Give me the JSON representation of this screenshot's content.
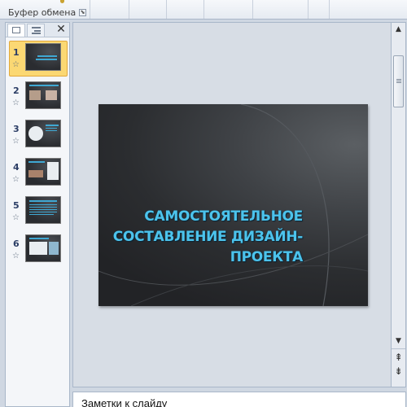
{
  "ribbon": {
    "group_label": "Буфер обмена",
    "launcher_glyph": "⬊"
  },
  "thumbnail_pane": {
    "close_glyph": "✕",
    "slides": [
      {
        "number": "1",
        "selected": true
      },
      {
        "number": "2",
        "selected": false
      },
      {
        "number": "3",
        "selected": false
      },
      {
        "number": "4",
        "selected": false
      },
      {
        "number": "5",
        "selected": false
      },
      {
        "number": "6",
        "selected": false
      }
    ],
    "star_glyph": "☆"
  },
  "slide": {
    "title": "Самостоятельное составление дизайн-проекта"
  },
  "scrollbar": {
    "up_glyph": "▲",
    "down_glyph": "▼",
    "prev_glyph": "⇞",
    "next_glyph": "⇟"
  },
  "notes": {
    "text": "Заметки к слайду"
  },
  "colors": {
    "title_text": "#4cc3ec",
    "selection_highlight": "#fbd873",
    "slide_background": "#2b2d30"
  }
}
